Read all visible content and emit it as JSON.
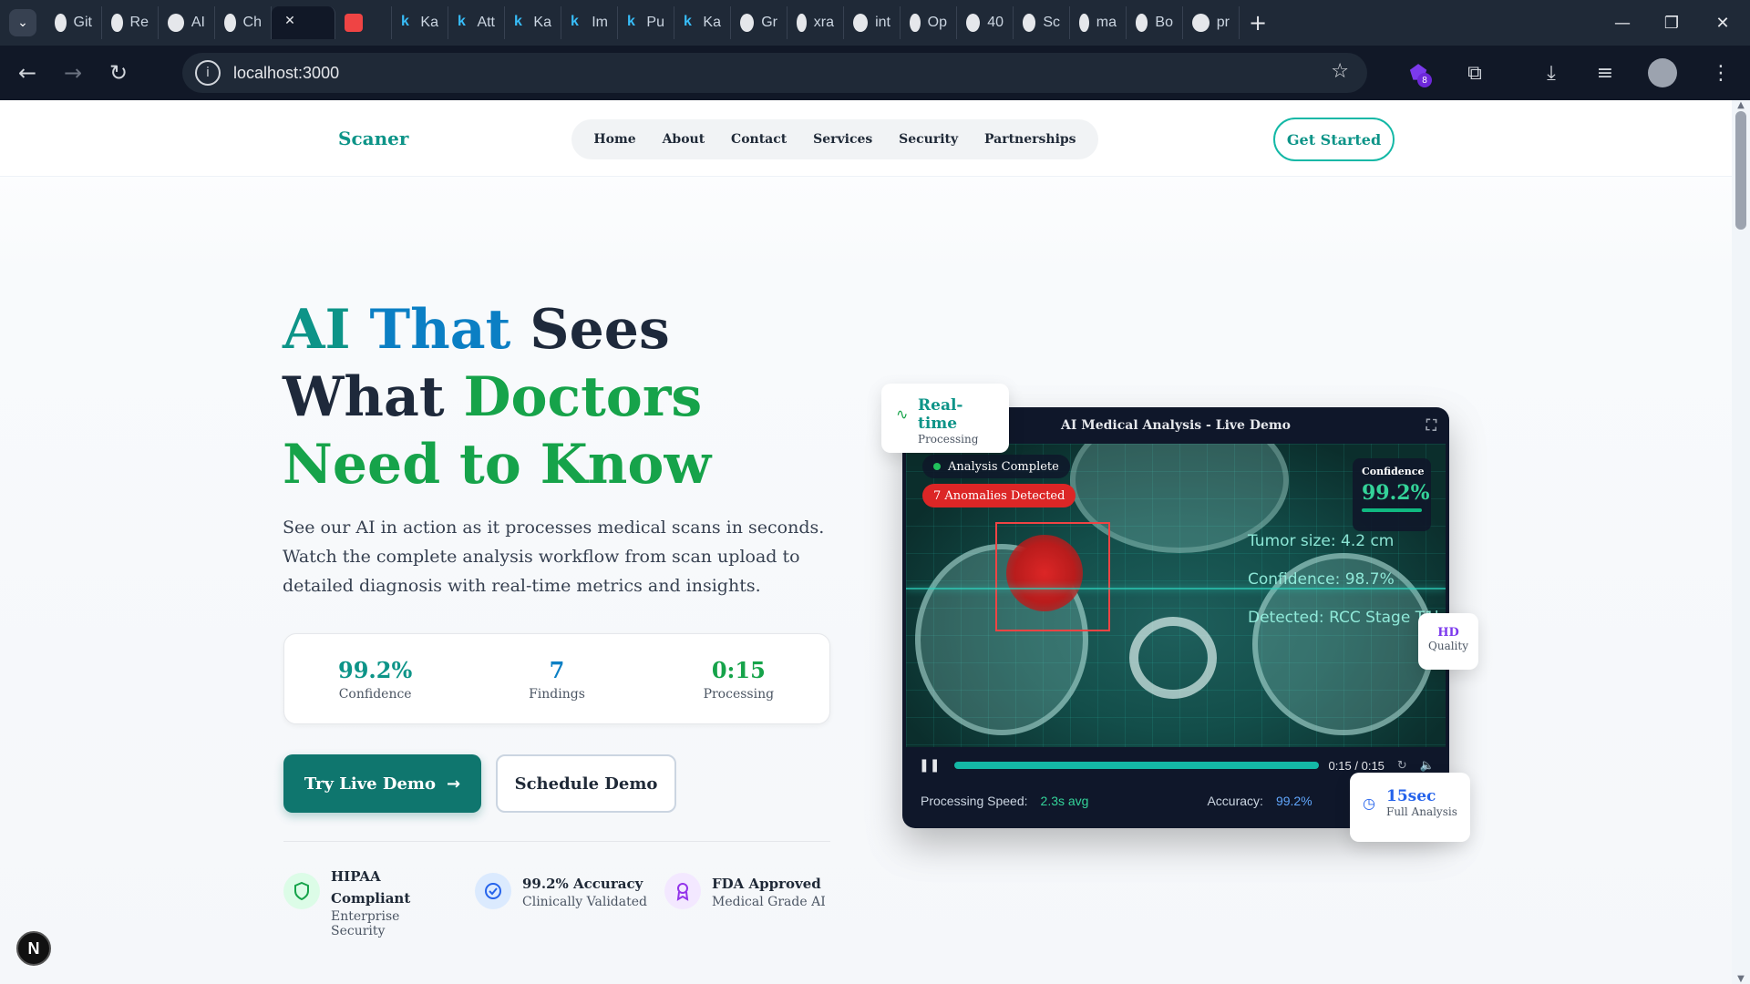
{
  "browser": {
    "tabs": [
      {
        "label": "Git",
        "icon": "github-icon"
      },
      {
        "label": "Re",
        "icon": "chatgpt-icon"
      },
      {
        "label": "AI",
        "icon": "chatgpt-icon"
      },
      {
        "label": "Ch",
        "icon": "chatgpt-icon"
      },
      {
        "label": "",
        "icon": "close-icon",
        "active": true
      },
      {
        "label": "",
        "icon": "youtube-icon"
      },
      {
        "label": "Ka",
        "icon": "k-icon"
      },
      {
        "label": "Att",
        "icon": "k-icon"
      },
      {
        "label": "Ka",
        "icon": "k-icon"
      },
      {
        "label": "Im",
        "icon": "k-icon"
      },
      {
        "label": "Pu",
        "icon": "k-icon"
      },
      {
        "label": "Ka",
        "icon": "k-icon"
      },
      {
        "label": "Gr",
        "icon": "grok-icon"
      },
      {
        "label": "xra",
        "icon": "docs-icon"
      },
      {
        "label": "int",
        "icon": "google-icon"
      },
      {
        "label": "Op",
        "icon": "shield-icon"
      },
      {
        "label": "40",
        "icon": "globe-icon"
      },
      {
        "label": "Sc",
        "icon": "vercel-icon"
      },
      {
        "label": "ma",
        "icon": "google-icon"
      },
      {
        "label": "Bo",
        "icon": "b-icon"
      },
      {
        "label": "pr",
        "icon": "app-icon"
      }
    ],
    "url": "localhost:3000",
    "extensions_badge": "8"
  },
  "nav": {
    "brand": "Scaner",
    "links": [
      "Home",
      "About",
      "Contact",
      "Services",
      "Security",
      "Partnerships"
    ],
    "cta": "Get Started"
  },
  "hero": {
    "title_part1": "AI That",
    "title_part1a": "AI ",
    "title_part1b": "That",
    "title_part2": " Sees What",
    "title_part3": "Doctors Need to Know",
    "subtitle": "See our AI in action as it processes medical scans in seconds. Watch the complete analysis workflow from scan upload to detailed diagnosis with real-time metrics and insights.",
    "stats": [
      {
        "value": "99.2%",
        "label": "Confidence",
        "color": "#0d9488"
      },
      {
        "value": "7",
        "label": "Findings",
        "color": "#0b7fc4"
      },
      {
        "value": "0:15",
        "label": "Processing",
        "color": "#16a34a"
      }
    ],
    "primary_button": "Try Live Demo",
    "secondary_button": "Schedule Demo",
    "badges": [
      {
        "title": "HIPAA Compliant",
        "sub": "Enterprise Security",
        "icon": "shield-icon",
        "color": "#16a34a"
      },
      {
        "title": "99.2% Accuracy",
        "sub": "Clinically Validated",
        "icon": "check-circle-icon",
        "color": "#2563eb"
      },
      {
        "title": "FDA Approved",
        "sub": "Medical Grade AI",
        "icon": "award-icon",
        "color": "#9333ea"
      }
    ]
  },
  "demo": {
    "title": "AI Medical Analysis - Live Demo",
    "status": "Analysis Complete",
    "anomalies": "7 Anomalies Detected",
    "confidence_label": "Confidence",
    "confidence_value": "99.2%",
    "overlay_lines": [
      "Tumor size: 4.2 cm",
      "Confidence: 98.7%",
      "Detected: RCC Stage T1b"
    ],
    "time": "0:15 / 0:15",
    "progress": 1.0,
    "speed_label": "Processing Speed:",
    "speed_value": "2.3s avg",
    "accuracy_label": "Accuracy:",
    "accuracy_value": "99.2%",
    "float_realtime": {
      "title": "Real-time",
      "sub": "Processing"
    },
    "float_hd": {
      "title": "HD",
      "sub": "Quality"
    },
    "float_time": {
      "title": "15sec",
      "sub": "Full Analysis"
    }
  },
  "colors": {
    "accent": "#0d9488",
    "primary_button": "#0f766e",
    "danger": "#dc2626"
  }
}
